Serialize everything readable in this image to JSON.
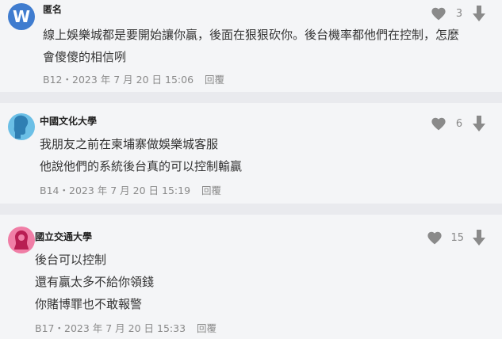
{
  "comments": [
    {
      "author": "匿名",
      "avatar_letter": "W",
      "lines": [
        "線上娛樂城都是要開始讓你贏，後面在狠狠砍你。後台機率都他們在控制，怎麼",
        "會傻傻的相信咧"
      ],
      "floor": "B12",
      "datetime": "2023 年 7 月 20 日 15:06",
      "reply_label": "回覆",
      "like_count": "3"
    },
    {
      "author": "中國文化大學",
      "lines": [
        "我朋友之前在柬埔寨做娛樂城客服",
        "他說他們的系統後台真的可以控制輸贏"
      ],
      "floor": "B14",
      "datetime": "2023 年 7 月 20 日 15:19",
      "reply_label": "回覆",
      "like_count": "6"
    },
    {
      "author": "國立交通大學",
      "lines": [
        "後台可以控制",
        "還有贏太多不給你領錢",
        "你賭博罪也不敢報警"
      ],
      "floor": "B17",
      "datetime": "2023 年 7 月 20 日 15:33",
      "reply_label": "回覆",
      "like_count": "15"
    }
  ],
  "icons": {
    "like": "heart-icon",
    "dislike": "arrow-down-icon"
  },
  "colors": {
    "icon_gray": "#8a8a8a",
    "avatar_blue_letter": "#3f7ccf",
    "avatar_school_blue": "#6bbfe6",
    "avatar_school_pink": "#f07ea6",
    "card_bg": "#f4f5f7",
    "page_bg": "#e9eaee"
  }
}
